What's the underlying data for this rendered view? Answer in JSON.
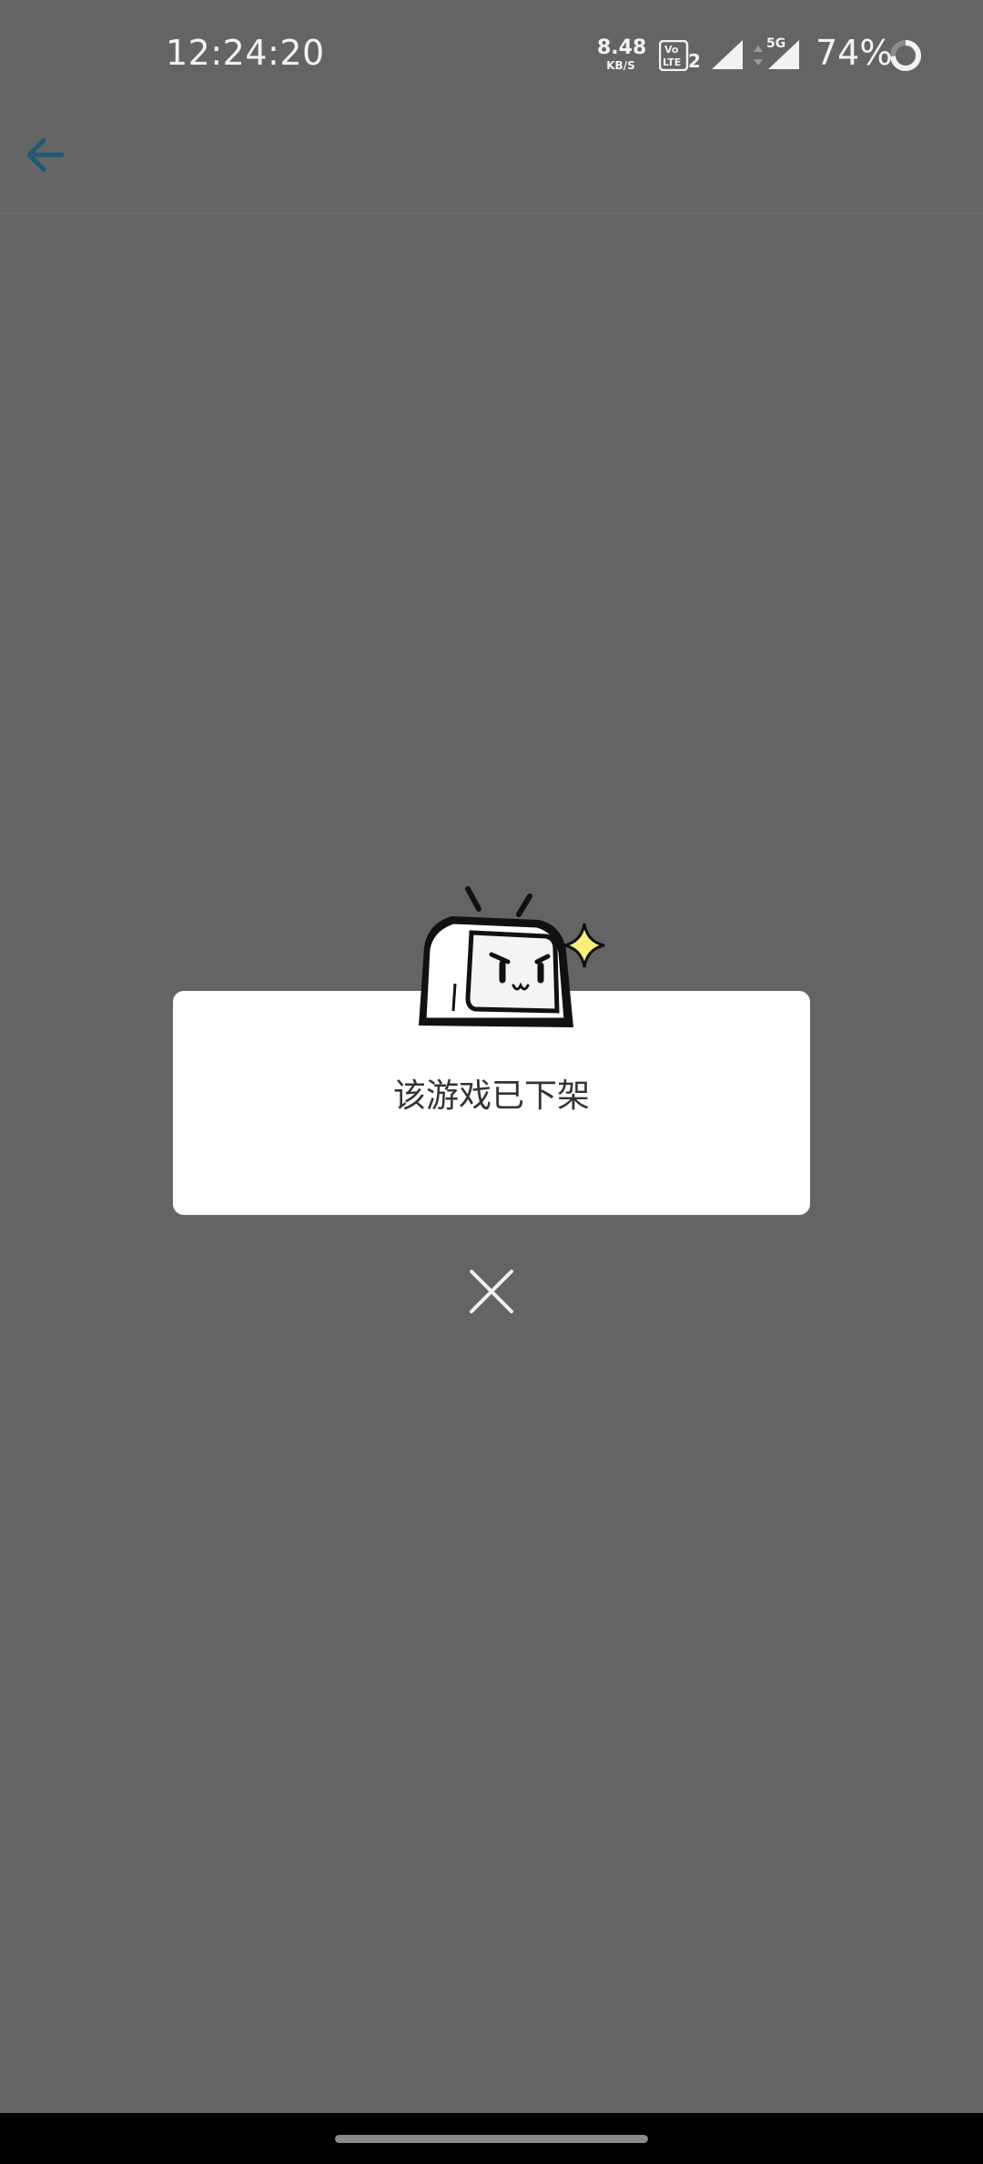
{
  "status_bar": {
    "time": "12:24:20",
    "net_speed_value": "8.48",
    "net_speed_unit": "KB/S",
    "network_type": "5G",
    "battery_percent": "74%",
    "icons": [
      "volte-lte2-icon",
      "signal-icon",
      "data-arrows-icon",
      "signal-5g-icon",
      "battery-ring-icon"
    ]
  },
  "toolbar": {
    "back_icon": "arrow-left-icon",
    "accent_color": "#1e5a73"
  },
  "dialog": {
    "message": "该游戏已下架",
    "illustration": "tv-mascot-illustration",
    "close_icon": "close-x-icon"
  },
  "colors": {
    "overlay_background": "#646464",
    "dialog_background": "#ffffff",
    "message_text": "#333333",
    "sparkle": "#f7f07a"
  }
}
